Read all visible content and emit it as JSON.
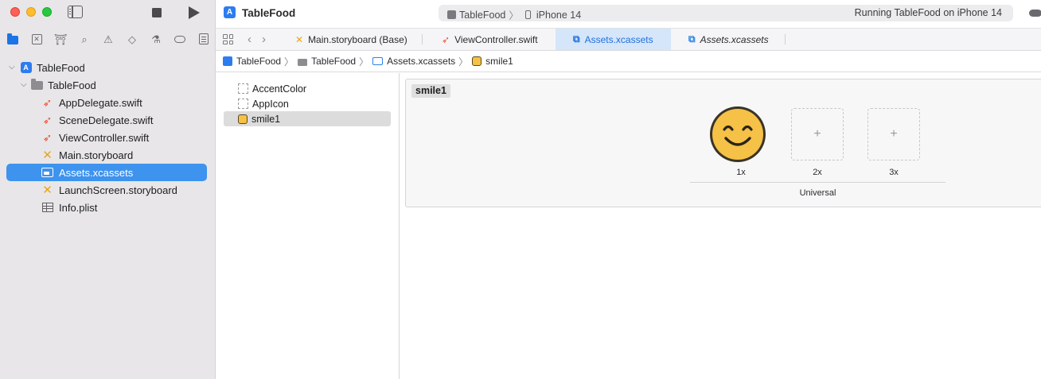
{
  "window": {
    "app_title": "TableFood",
    "scheme": {
      "target": "TableFood",
      "separator": "〉",
      "device": "iPhone 14"
    },
    "status": "Running TableFood on iPhone 14"
  },
  "sidebar": {
    "tree": [
      {
        "label": "TableFood",
        "kind": "project",
        "icon": "xcode-project-icon",
        "depth": 0,
        "expanded": true
      },
      {
        "label": "TableFood",
        "kind": "folder",
        "icon": "folder-icon",
        "depth": 1,
        "expanded": true
      },
      {
        "label": "AppDelegate.swift",
        "kind": "swift",
        "icon": "swift-icon",
        "depth": 2
      },
      {
        "label": "SceneDelegate.swift",
        "kind": "swift",
        "icon": "swift-icon",
        "depth": 2
      },
      {
        "label": "ViewController.swift",
        "kind": "swift",
        "icon": "swift-icon",
        "depth": 2
      },
      {
        "label": "Main.storyboard",
        "kind": "storyboard",
        "icon": "storyboard-icon",
        "depth": 2
      },
      {
        "label": "Assets.xcassets",
        "kind": "xcassets",
        "icon": "asset-catalog-icon",
        "depth": 2,
        "selected": true
      },
      {
        "label": "LaunchScreen.storyboard",
        "kind": "storyboard",
        "icon": "storyboard-icon",
        "depth": 2
      },
      {
        "label": "Info.plist",
        "kind": "plist",
        "icon": "plist-icon",
        "depth": 2
      }
    ]
  },
  "tabs": [
    {
      "label": "Main.storyboard (Base)",
      "icon": "storyboard-icon"
    },
    {
      "label": "ViewController.swift",
      "icon": "swift-icon"
    },
    {
      "label": "Assets.xcassets",
      "icon": "asset-catalog-icon",
      "active": true
    },
    {
      "label": "Assets.xcassets",
      "icon": "asset-catalog-icon",
      "italic": true
    }
  ],
  "breadcrumb": [
    {
      "label": "TableFood",
      "icon": "xcode-project-icon"
    },
    {
      "label": "TableFood",
      "icon": "folder-icon"
    },
    {
      "label": "Assets.xcassets",
      "icon": "asset-catalog-icon"
    },
    {
      "label": "smile1",
      "icon": "image-set-icon"
    }
  ],
  "asset_list": [
    {
      "label": "AccentColor",
      "icon": "color-set-icon"
    },
    {
      "label": "AppIcon",
      "icon": "app-icon-set-icon"
    },
    {
      "label": "smile1",
      "icon": "image-set-icon",
      "selected": true
    }
  ],
  "editor": {
    "set_name": "smile1",
    "slots": [
      {
        "label": "1x",
        "filled": true,
        "empty_glyph": "+"
      },
      {
        "label": "2x",
        "filled": false,
        "empty_glyph": "+"
      },
      {
        "label": "3x",
        "filled": false,
        "empty_glyph": "+"
      }
    ],
    "group_label": "Universal"
  },
  "colors": {
    "accent": "#1c74e6",
    "selection": "#3e93ee",
    "smiley_yellow": "#f5c146"
  }
}
